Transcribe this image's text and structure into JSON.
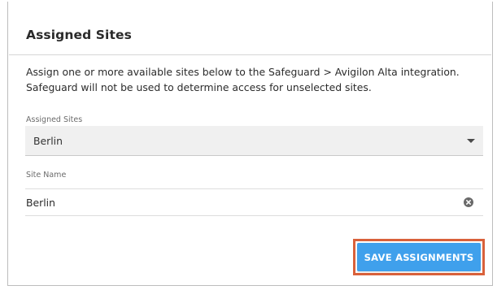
{
  "card": {
    "title": "Assigned Sites",
    "description_line1": "Assign one or more available sites below to the Safeguard > Avigilon Alta integration.",
    "description_line2": "Safeguard will not be used to determine access for unselected sites."
  },
  "assigned_sites": {
    "label": "Assigned Sites",
    "selected": "Berlin",
    "icon": "chevron-down-icon"
  },
  "site_name": {
    "label": "Site Name",
    "value": "Berlin",
    "clear_icon": "close-circle-icon"
  },
  "actions": {
    "save_label": "SAVE ASSIGNMENTS"
  },
  "colors": {
    "button": "#3fa0ec",
    "highlight": "#d9613b",
    "select_bg": "#f0f0f0"
  }
}
